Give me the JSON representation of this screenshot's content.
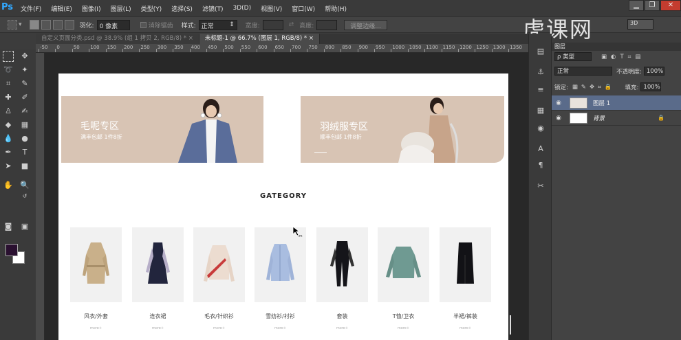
{
  "app": {
    "logo": "Ps"
  },
  "menu": [
    "文件(F)",
    "编辑(E)",
    "图像(I)",
    "图层(L)",
    "类型(Y)",
    "选择(S)",
    "滤镜(T)",
    "3D(D)",
    "视图(V)",
    "窗口(W)",
    "帮助(H)"
  ],
  "window_controls": {
    "minimize": "▁",
    "restore": "❐",
    "close": "✕"
  },
  "options": {
    "feather_label": "羽化:",
    "feather_value": "0 像素",
    "antialias_label": "消除锯齿",
    "style_label": "样式:",
    "style_value": "正常",
    "width_label": "宽度:",
    "height_label": "高度:",
    "refine_edge": "调整边缘...",
    "workspace": "3D"
  },
  "watermark": "虎课网",
  "tabs": [
    {
      "label": "自定义页面分类.psd @ 38.9% (组 1 拷贝 2, RGB/8) *",
      "close": "×"
    },
    {
      "label": "未标题-1 @ 66.7% (图层 1, RGB/8) *",
      "close": "×"
    }
  ],
  "ruler": [
    "-50",
    "0",
    "50",
    "100",
    "150",
    "200",
    "250",
    "300",
    "350",
    "400",
    "450",
    "500",
    "550",
    "600",
    "650",
    "700",
    "750",
    "800",
    "850",
    "900",
    "950",
    "1000",
    "1050",
    "1100",
    "1150",
    "1200",
    "1250",
    "1300",
    "1350"
  ],
  "document": {
    "banners": [
      {
        "title": "毛呢专区",
        "subtitle": "满丰包邮 1件8折"
      },
      {
        "title": "羽绒服专区",
        "subtitle": "顺丰包邮 1件8折"
      }
    ],
    "category_title": "GATEGORY",
    "categories": [
      {
        "label": "风衣/外套",
        "sub": "more+"
      },
      {
        "label": "连衣裙",
        "sub": "more+"
      },
      {
        "label": "毛衣/针织衫",
        "sub": "more+"
      },
      {
        "label": "雪纺衫/衬衫",
        "sub": "more+"
      },
      {
        "label": "套装",
        "sub": "more+"
      },
      {
        "label": "T恤/卫衣",
        "sub": "more+"
      },
      {
        "label": "半裙/裤装",
        "sub": "more+"
      }
    ]
  },
  "layers_panel": {
    "tab": "图层",
    "filter_kind": "ρ 类型",
    "blend_mode": "正常",
    "opacity_label": "不透明度:",
    "opacity_value": "100%",
    "lock_label": "锁定:",
    "fill_label": "填充:",
    "fill_value": "100%",
    "layers": [
      {
        "name": "图层 1",
        "selected": true
      },
      {
        "name": "背景",
        "selected": false
      }
    ]
  },
  "colors": {
    "accent": "#31a8ff",
    "selected_layer": "#5a6b8a",
    "banner": "#d8c4b4",
    "foreground": "#2a1030"
  }
}
